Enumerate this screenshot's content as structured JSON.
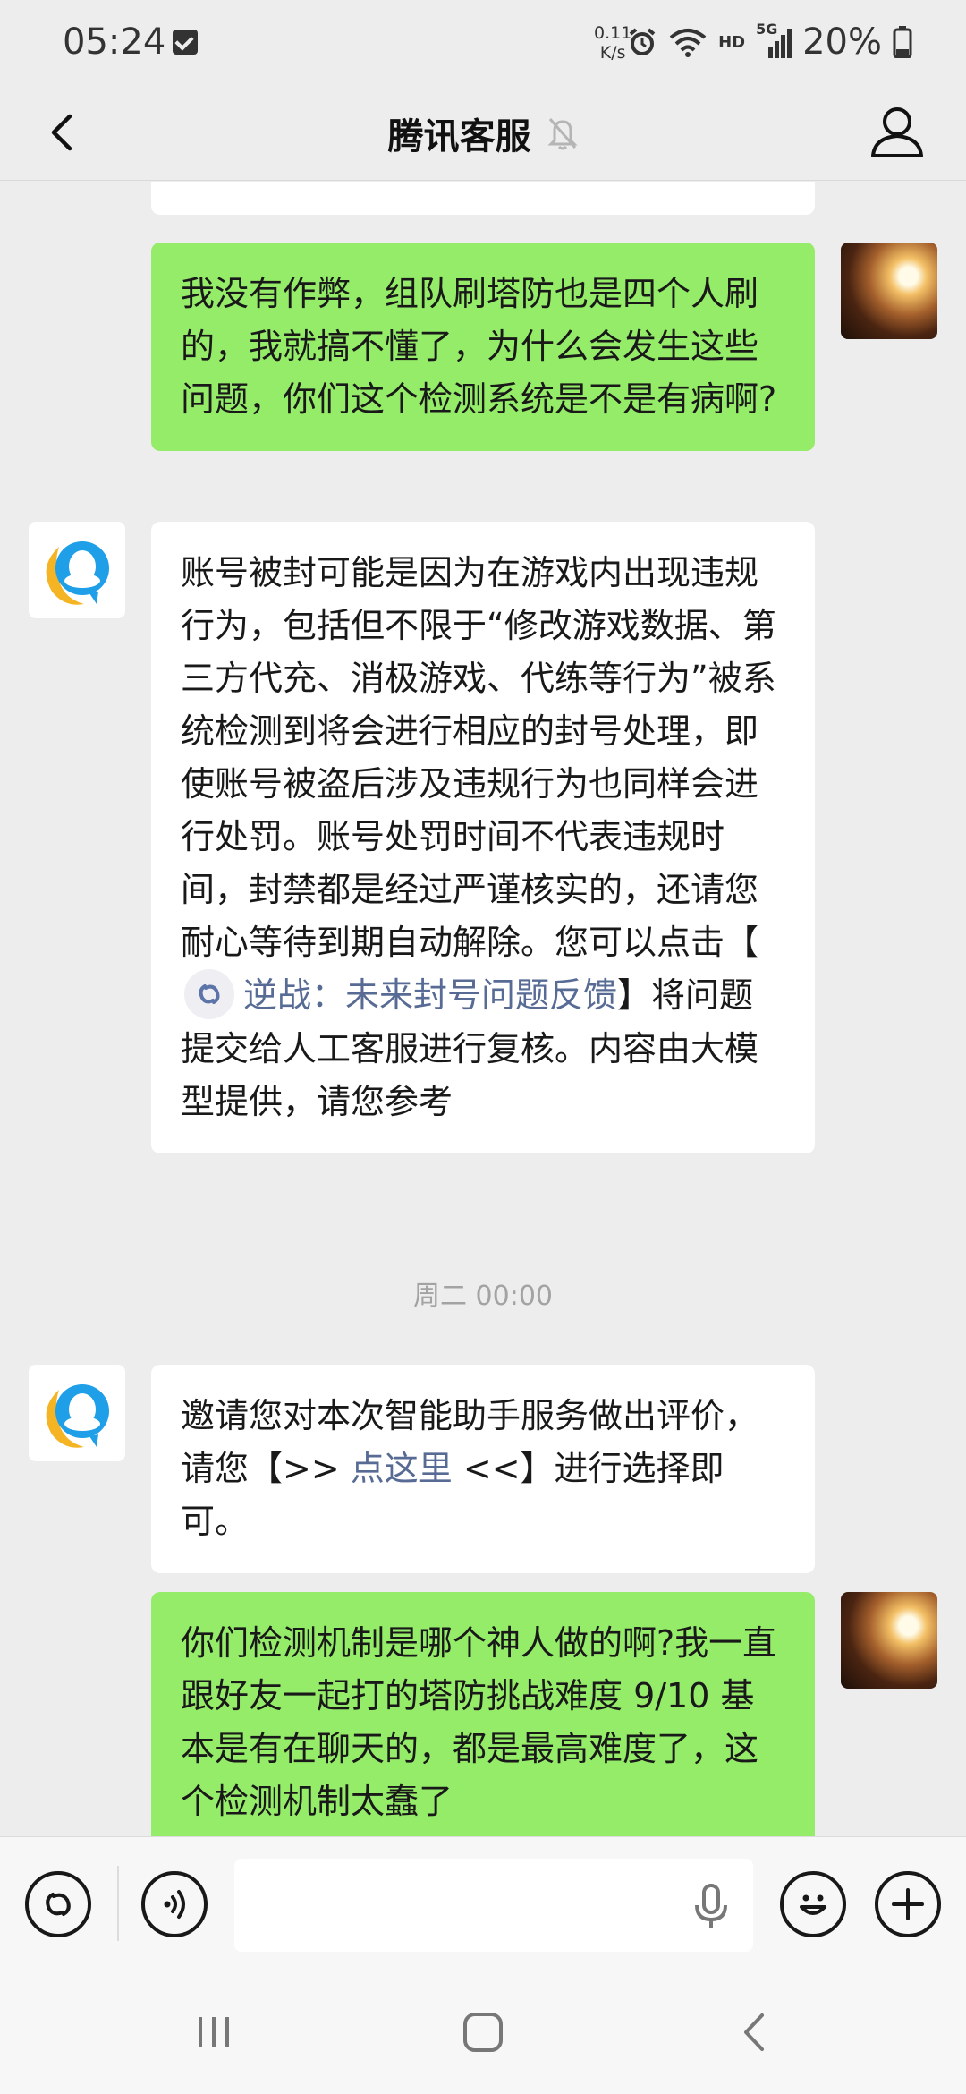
{
  "status": {
    "time": "05:24",
    "speed_value": "0.11",
    "speed_unit": "K/s",
    "hd": "HD",
    "network": "5G",
    "battery": "20%"
  },
  "header": {
    "title": "腾讯客服"
  },
  "messages": [
    {
      "side": "right",
      "text": "我没有作弊，组队刷塔防也是四个人刷的，我就搞不懂了，为什么会发生这些问题，你们这个检测系统是不是有病啊?"
    },
    {
      "side": "left",
      "text_before": "账号被封可能是因为在游戏内出现违规行为，包括但不限于“修改游戏数据、第三方代充、消极游戏、代练等行为”被系统检测到将会进行相应的封号处理，即使账号被盗后涉及违规行为也同样会进行处罚。账号处罚时间不代表违规时间，封禁都是经过严谨核实的，还请您耐心等待到期自动解除。您可以点击【",
      "link": "逆战：未来封号问题反馈",
      "text_after": "】将问题提交给人工客服进行复核。内容由大模型提供，请您参考"
    },
    {
      "side": "left",
      "text_before": "邀请您对本次智能助手服务做出评价，请您【>> ",
      "link": "点这里",
      "text_after": " <<】进行选择即可。"
    },
    {
      "side": "right",
      "text": "你们检测机制是哪个神人做的啊?我一直跟好友一起打的塔防挑战难度 9/10 基本是有在聊天的，都是最高难度了，这个检测机制太蠢了"
    }
  ],
  "timestamp": "周二 00:00",
  "colors": {
    "sent_bubble": "#95ec69",
    "received_bubble": "#ffffff",
    "link": "#576b95",
    "background": "#ededed"
  }
}
